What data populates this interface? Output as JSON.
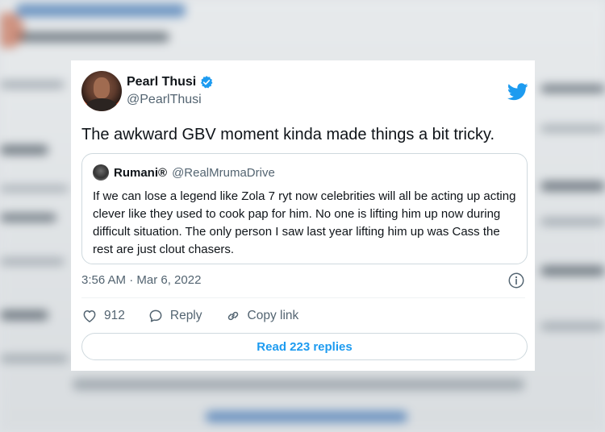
{
  "tweet": {
    "author": {
      "display_name": "Pearl Thusi",
      "handle": "@PearlThusi",
      "verified": true
    },
    "text": "The awkward GBV moment kinda made things a bit tricky.",
    "quoted": {
      "display_name": "Rumani®",
      "handle": "@RealMrumaDrive",
      "text": "If we can lose a legend like Zola 7 ryt now celebrities will all be acting up acting clever like they used to cook pap for him. No one is lifting him up now during difficult situation. The only person I saw last year lifting him up was Cass the rest are just clout chasers."
    },
    "timestamp": "3:56 AM · Mar 6, 2022",
    "actions": {
      "likes": "912",
      "reply_label": "Reply",
      "copy_link_label": "Copy link"
    },
    "read_replies_label": "Read 223 replies"
  },
  "icons": {
    "verified": "verified-badge-icon",
    "logo": "twitter-bird-icon",
    "info": "info-icon",
    "like": "heart-icon",
    "reply": "speech-bubble-icon",
    "copy_link": "link-icon"
  },
  "colors": {
    "accent": "#1d9bf0",
    "text_primary": "#0f1419",
    "text_secondary": "#536471",
    "border": "#cfd9de"
  }
}
